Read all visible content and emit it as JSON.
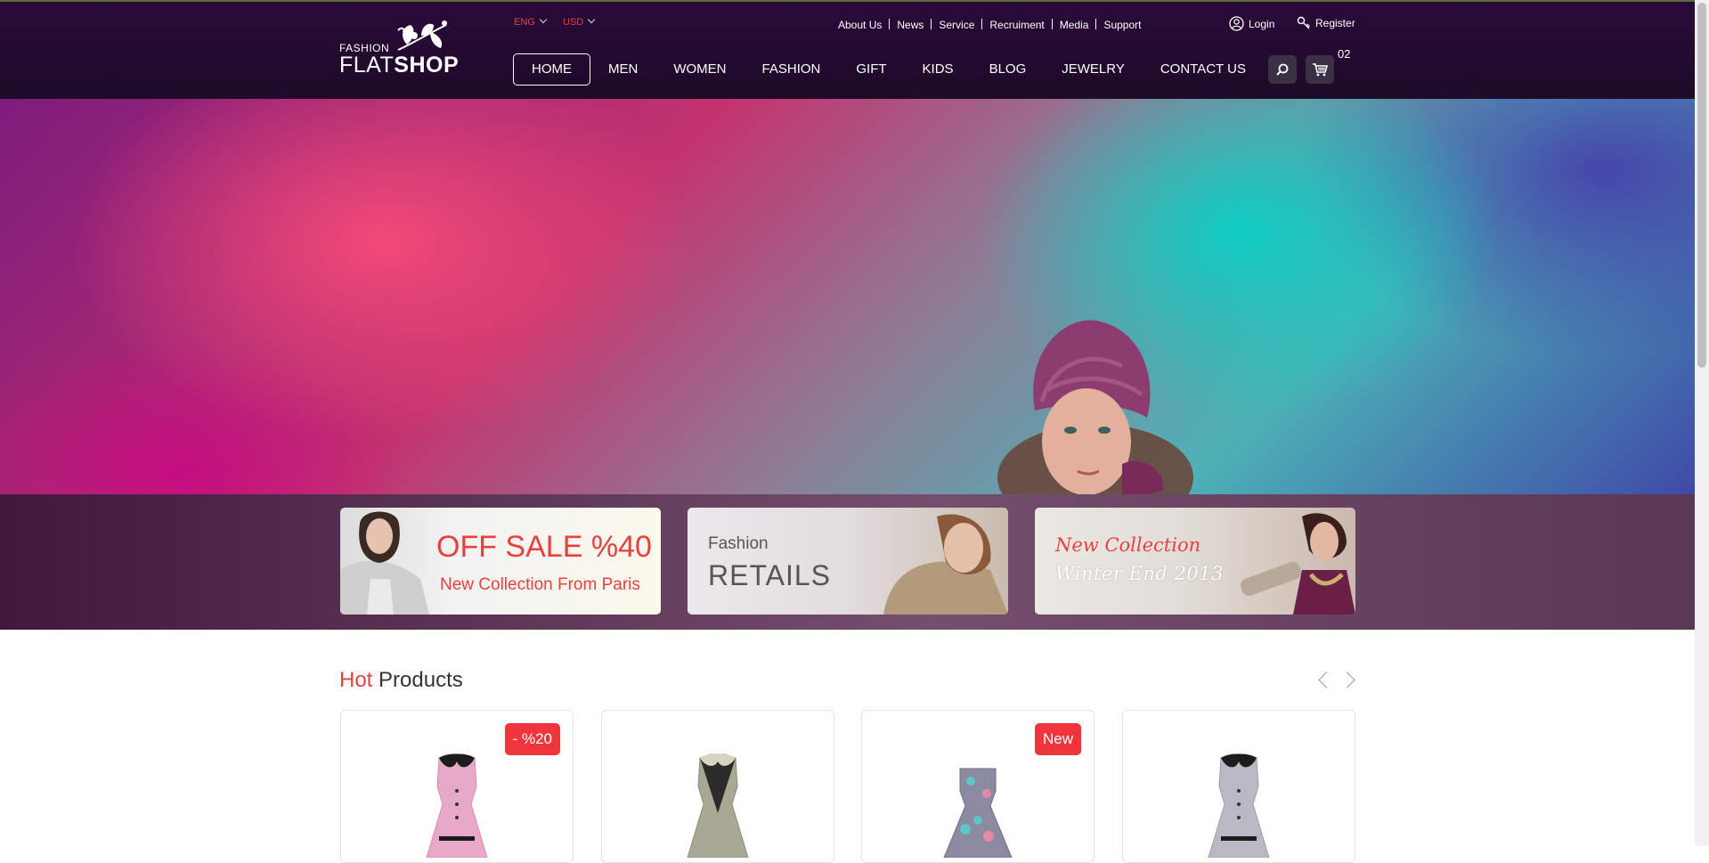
{
  "header": {
    "logo": {
      "small": "FASHION",
      "flat": "FLAT",
      "shop": "SHOP"
    },
    "language": "ENG",
    "currency": "USD",
    "top_links": [
      "About Us",
      "News",
      "Service",
      "Recruiment",
      "Media",
      "Support"
    ],
    "login": "Login",
    "register": "Register",
    "nav": [
      "HOME",
      "MEN",
      "WOMEN",
      "FASHION",
      "GIFT",
      "KIDS",
      "BLOG",
      "JEWELRY",
      "CONTACT US"
    ],
    "active_nav": "HOME",
    "cart_count": "02"
  },
  "banners": {
    "sale": {
      "title": "OFF SALE %40",
      "subtitle": "New Collection From Paris"
    },
    "retails": {
      "title": "Fashion",
      "subtitle": "RETAILS"
    },
    "collection": {
      "title": "New Collection",
      "subtitle": "Winter End 2013"
    }
  },
  "hot_products": {
    "title_accent": "Hot",
    "title_rest": "Products",
    "items": [
      {
        "badge": "- %20",
        "color": "#e8a9c8"
      },
      {
        "badge": "",
        "color": "#a9a894"
      },
      {
        "badge": "New",
        "color": "#8c8aa0"
      },
      {
        "badge": "",
        "color": "#b9b9c6"
      }
    ]
  },
  "colors": {
    "accent": "#e8413d",
    "header_bg": "#230a2f",
    "badge": "#f0363c"
  }
}
